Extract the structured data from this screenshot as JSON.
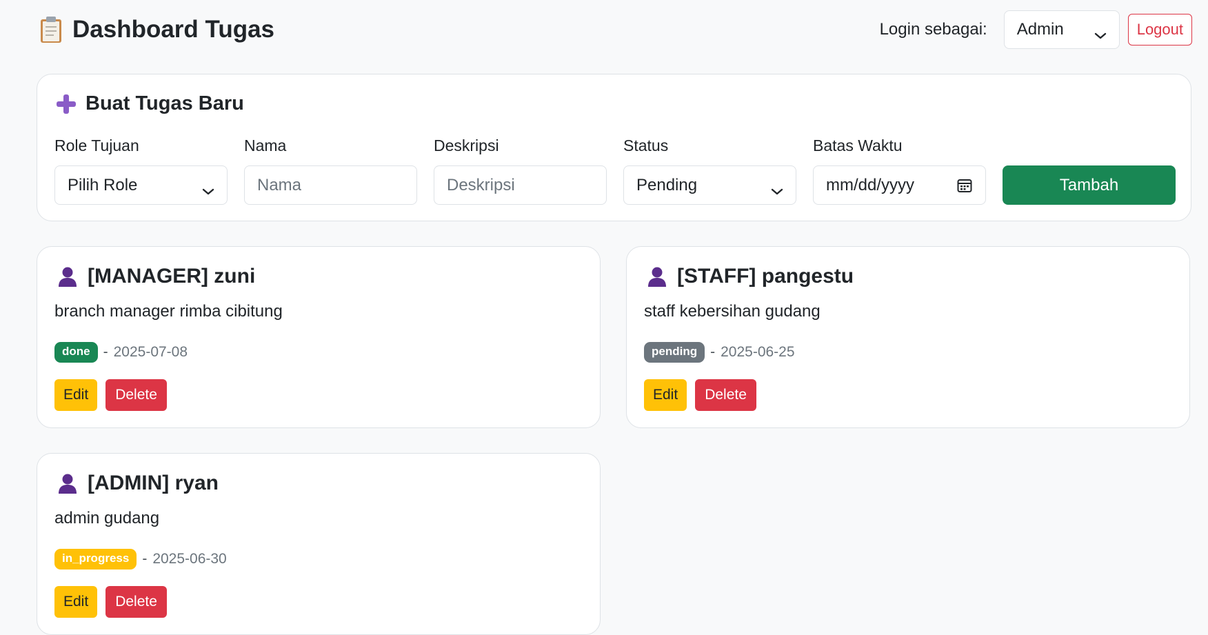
{
  "header": {
    "title": "Dashboard Tugas",
    "title_icon": "clipboard-icon",
    "login_label": "Login sebagai:",
    "role_selected": "Admin",
    "logout_label": "Logout"
  },
  "form": {
    "title": "Buat Tugas Baru",
    "title_icon": "plus-icon",
    "role_label": "Role Tujuan",
    "role_value": "Pilih Role",
    "name_label": "Nama",
    "name_placeholder": "Nama",
    "desc_label": "Deskripsi",
    "desc_placeholder": "Deskripsi",
    "status_label": "Status",
    "status_value": "Pending",
    "deadline_label": "Batas Waktu",
    "deadline_placeholder": "mm/dd/yyyy",
    "submit_label": "Tambah"
  },
  "tasks": [
    {
      "title": "[MANAGER] zuni",
      "description": "branch manager rimba cibitung",
      "status": "done",
      "separator": "-",
      "date": "2025-07-08",
      "edit_label": "Edit",
      "delete_label": "Delete"
    },
    {
      "title": "[STAFF] pangestu",
      "description": "staff kebersihan gudang",
      "status": "pending",
      "separator": "-",
      "date": "2025-06-25",
      "edit_label": "Edit",
      "delete_label": "Delete"
    },
    {
      "title": "[ADMIN] ryan",
      "description": "admin gudang",
      "status": "in_progress",
      "separator": "-",
      "date": "2025-06-30",
      "edit_label": "Edit",
      "delete_label": "Delete"
    }
  ],
  "colors": {
    "success": "#198754",
    "danger": "#dc3545",
    "warning": "#ffc107",
    "secondary": "#6c757d",
    "accent_purple": "#8a5cc7"
  }
}
